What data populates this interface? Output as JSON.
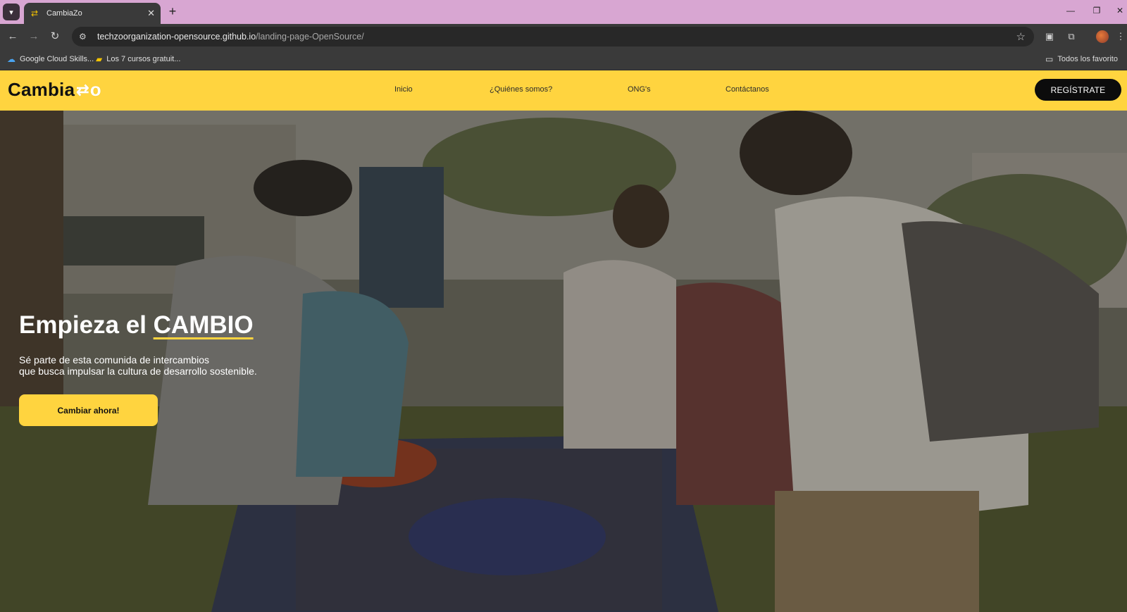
{
  "browser": {
    "tab_title": "CambiaZo",
    "url_host": "techzoorganization-opensource.github.io",
    "url_path": "/landing-page-OpenSource/",
    "bookmarks": [
      {
        "label": "Google Cloud Skills..."
      },
      {
        "label": "Los 7 cursos gratuit..."
      }
    ],
    "all_bookmarks_label": "Todos los favorito"
  },
  "site": {
    "logo_text": "Cambia",
    "logo_tail": "o",
    "nav": [
      {
        "label": "Inicio"
      },
      {
        "label": "¿Quiénes somos?"
      },
      {
        "label": "ONG's"
      },
      {
        "label": "Contáctanos"
      }
    ],
    "register_label": "REGÍSTRATE"
  },
  "hero": {
    "title_prefix": "Empieza el ",
    "title_accent": "CAMBIO",
    "subtitle_line1": "Sé parte de esta comunida de intercambios",
    "subtitle_line2": "que busca impulsar la cultura de desarrollo sostenible.",
    "cta_label": "Cambiar ahora!"
  },
  "colors": {
    "brand_yellow": "#ffd43f",
    "tab_strip": "#d8a6d2",
    "register_bg": "#0c0c0c"
  }
}
